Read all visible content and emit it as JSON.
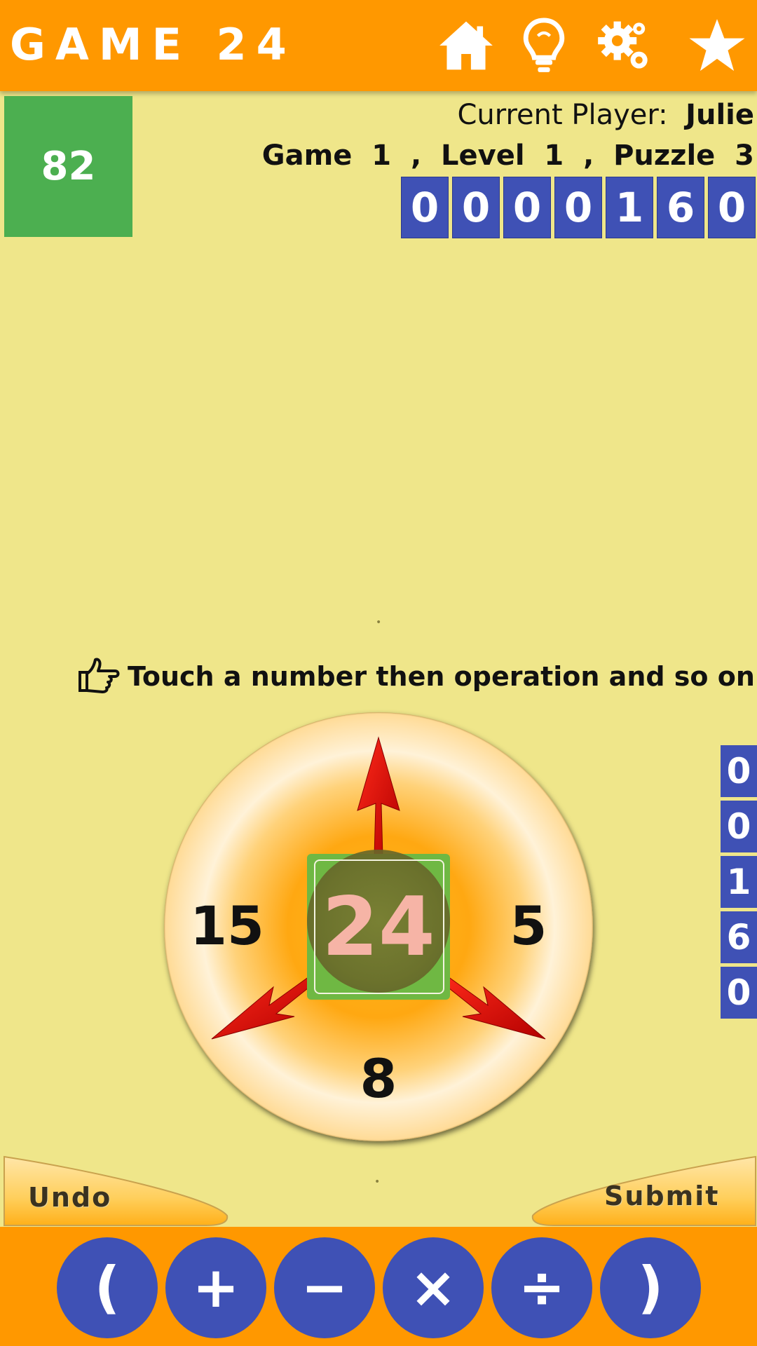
{
  "header": {
    "title": "GAME 24",
    "icons": [
      "home-icon",
      "lightbulb-icon",
      "gears-icon",
      "star-icon"
    ]
  },
  "score_box": {
    "value": "82"
  },
  "player": {
    "label": "Current Player:",
    "name": "Julie"
  },
  "game_info": {
    "text": "Game  1  ,  Level  1  ,  Puzzle  3"
  },
  "score_digits": [
    "0",
    "0",
    "0",
    "0",
    "1",
    "6",
    "0"
  ],
  "side_digits": [
    "0",
    "0",
    "1",
    "6",
    "0"
  ],
  "hint": {
    "icon": "pointing-hand-icon",
    "text": "Touch a number then operation and so on!"
  },
  "wheel": {
    "left_number": "15",
    "right_number": "5",
    "bottom_number": "8",
    "target": "24"
  },
  "actions": {
    "undo": "Undo",
    "submit": "Submit"
  },
  "operators": [
    "(",
    "+",
    "−",
    "×",
    "÷",
    ")"
  ],
  "colors": {
    "header_orange": "#ff9800",
    "background": "#efe68a",
    "score_green": "#4caf50",
    "digit_blue": "#3f51b5",
    "arrow_red": "#cc0000"
  }
}
